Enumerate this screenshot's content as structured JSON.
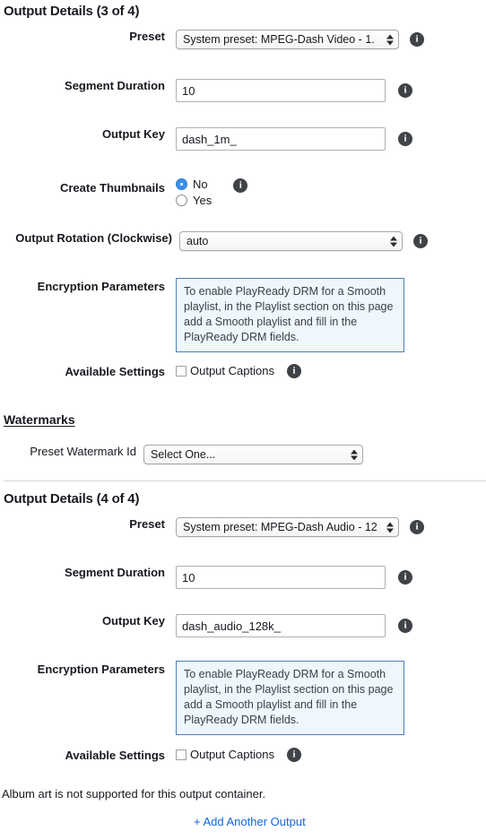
{
  "outputs": [
    {
      "title": "Output Details (3 of 4)",
      "fields": {
        "preset_label": "Preset",
        "preset_value": "System preset: MPEG-Dash Video - 1.",
        "segment_duration_label": "Segment Duration",
        "segment_duration_value": "10",
        "output_key_label": "Output Key",
        "output_key_value": "dash_1m_",
        "create_thumbnails_label": "Create Thumbnails",
        "thumbnail_options": [
          {
            "label": "No",
            "selected": true
          },
          {
            "label": "Yes",
            "selected": false
          }
        ],
        "output_rotation_label": "Output Rotation (Clockwise)",
        "output_rotation_value": "auto",
        "encryption_label": "Encryption Parameters",
        "encryption_text": "To enable PlayReady DRM for a Smooth playlist, in the Playlist section on this page add a Smooth playlist and fill in the PlayReady DRM fields.",
        "available_settings_label": "Available Settings",
        "output_captions_label": "Output Captions",
        "output_captions_checked": false
      }
    },
    {
      "title": "Output Details (4 of 4)",
      "fields": {
        "preset_label": "Preset",
        "preset_value": "System preset: MPEG-Dash Audio - 12",
        "segment_duration_label": "Segment Duration",
        "segment_duration_value": "10",
        "output_key_label": "Output Key",
        "output_key_value": "dash_audio_128k_",
        "encryption_label": "Encryption Parameters",
        "encryption_text": "To enable PlayReady DRM for a Smooth playlist, in the Playlist section on this page add a Smooth playlist and fill in the PlayReady DRM fields.",
        "available_settings_label": "Available Settings",
        "output_captions_label": "Output Captions",
        "output_captions_checked": false
      }
    }
  ],
  "watermarks": {
    "title": "Watermarks",
    "preset_watermark_id_label": "Preset Watermark Id",
    "preset_watermark_id_value": "Select One..."
  },
  "footer": {
    "album_art_note": "Album art is not supported for this output container.",
    "add_output_link": "+ Add Another Output"
  },
  "icons": {
    "info": "i"
  },
  "colors": {
    "link": "#1166dd",
    "info_box_bg": "#eff6fc",
    "info_box_border": "#4a7ebb",
    "radio_selected": "#3b8eea",
    "text": "#16191f"
  }
}
